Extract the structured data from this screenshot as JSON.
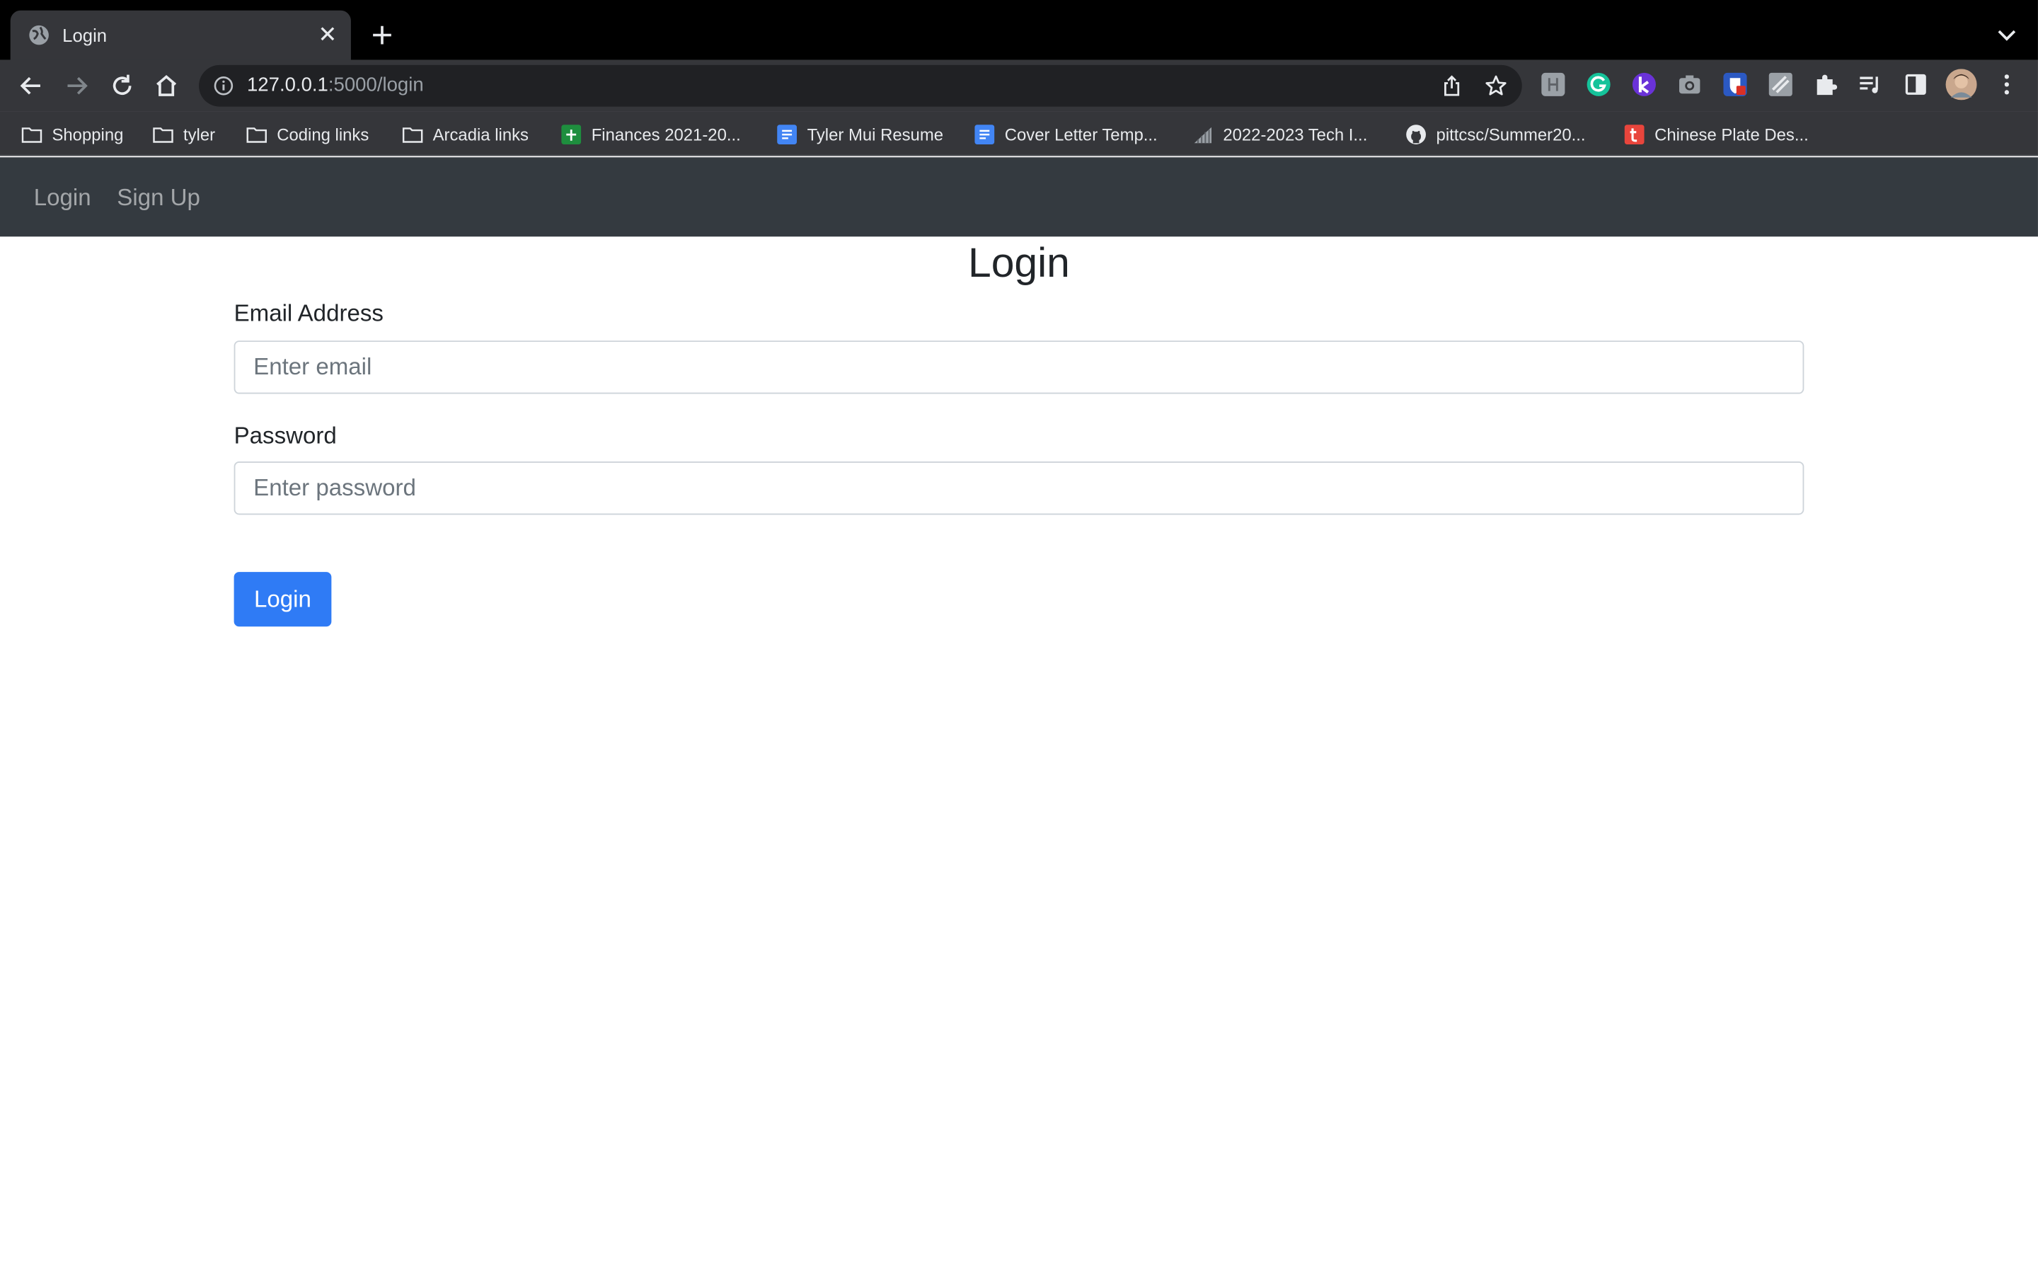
{
  "browser": {
    "tab_title": "Login",
    "url_host": "127.0.0.1",
    "url_rest": ":5000/login"
  },
  "bookmarks": [
    {
      "label": "Shopping",
      "icon": "folder-icon"
    },
    {
      "label": "tyler",
      "icon": "folder-icon"
    },
    {
      "label": "Coding links",
      "icon": "folder-icon"
    },
    {
      "label": "Arcadia links",
      "icon": "folder-icon"
    },
    {
      "label": "Finances 2021-20...",
      "icon": "sheets-icon"
    },
    {
      "label": "Tyler Mui Resume",
      "icon": "docs-icon"
    },
    {
      "label": "Cover Letter Temp...",
      "icon": "docs-icon"
    },
    {
      "label": "2022-2023 Tech I...",
      "icon": "chart-icon"
    },
    {
      "label": "pittcsc/Summer20...",
      "icon": "github-icon"
    },
    {
      "label": "Chinese Plate Des...",
      "icon": "t-icon"
    }
  ],
  "nav": {
    "login": "Login",
    "signup": "Sign Up"
  },
  "form": {
    "title": "Login",
    "email_label": "Email Address",
    "email_placeholder": "Enter email",
    "email_value": "",
    "password_label": "Password",
    "password_placeholder": "Enter password",
    "password_value": "",
    "submit_label": "Login"
  },
  "colors": {
    "primary": "#2f7bf5",
    "navbar": "#343a40",
    "chrome": "#35363a"
  }
}
